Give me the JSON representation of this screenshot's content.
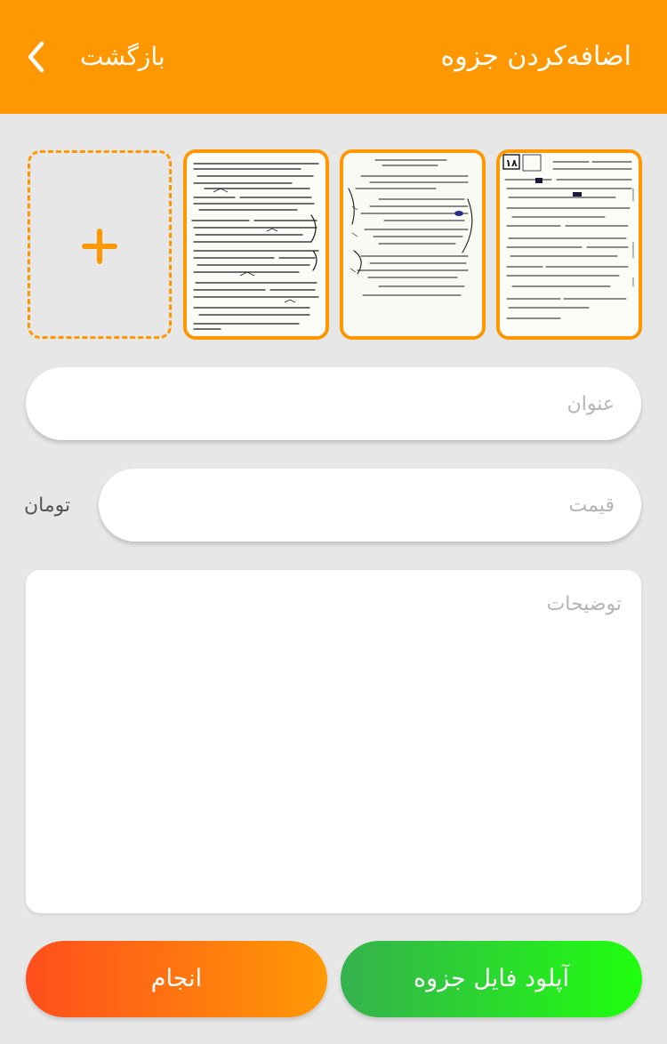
{
  "colors": {
    "accent": "#ff9800",
    "background": "#e7e7e7",
    "done_button_gradient": [
      "#ff4e1c",
      "#ff9a05"
    ],
    "upload_button_gradient": [
      "#36b14e",
      "#20ff0f"
    ]
  },
  "header": {
    "title": "اضافه‌کردن جزوه",
    "back_label": "بازگشت",
    "back_icon": "chevron-left-icon"
  },
  "images": {
    "add_icon": "plus-icon",
    "thumbnails": [
      {
        "name": "notes-page-1",
        "page_number": ""
      },
      {
        "name": "notes-page-2",
        "page_number": ""
      },
      {
        "name": "notes-page-3",
        "page_number": "۱۸"
      }
    ]
  },
  "form": {
    "title_placeholder": "عنوان",
    "title_value": "",
    "price_placeholder": "قیمت",
    "price_value": "",
    "currency": "تومان",
    "description_placeholder": "توضیحات",
    "description_value": ""
  },
  "buttons": {
    "done": "انجام",
    "upload": "آپلود فایل جزوه"
  }
}
